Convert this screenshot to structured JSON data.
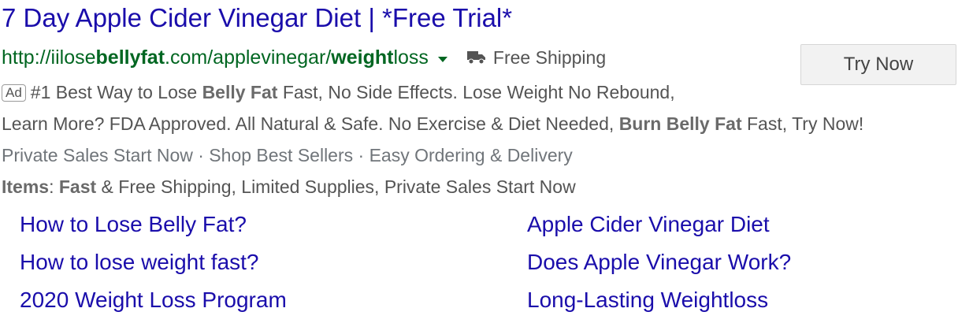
{
  "ad": {
    "title": "7 Day Apple Cider Vinegar Diet | *Free Trial*",
    "url": {
      "seg1": "http://iilose",
      "seg2": "bellyfat",
      "seg3": ".com/applevinegar/",
      "seg4": "weight",
      "seg5": "loss"
    },
    "shipping_label": "Free Shipping",
    "cta_label": "Try Now",
    "badge": "Ad",
    "line1": {
      "a": "#1 Best Way to Lose ",
      "b": "Belly Fat",
      "c": " Fast, No Side Effects. Lose Weight No Rebound,"
    },
    "line2": {
      "a": "Learn More? FDA Approved. All Natural & Safe. No Exercise & Diet Needed, ",
      "b": "Burn Belly Fat",
      "c": " Fast, Try Now!"
    },
    "callouts": "Private Sales Start Now · Shop Best Sellers · Easy Ordering & Delivery",
    "snippet": {
      "label": "Items",
      "sep": ": ",
      "bold": "Fast",
      "rest": " & Free Shipping, Limited Supplies, Private Sales Start Now"
    },
    "sitelinks": [
      "How to Lose Belly Fat?",
      "How to lose weight fast?",
      "2020 Weight Loss Program",
      "Apple Cider Vinegar Diet",
      "Does Apple Vinegar Work?",
      "Long-Lasting Weightloss"
    ]
  },
  "colors": {
    "title": "#1a0dab",
    "url": "#006621",
    "text": "#545454"
  },
  "icons": {
    "truck": "truck-icon",
    "caret": "caret-down-icon"
  }
}
